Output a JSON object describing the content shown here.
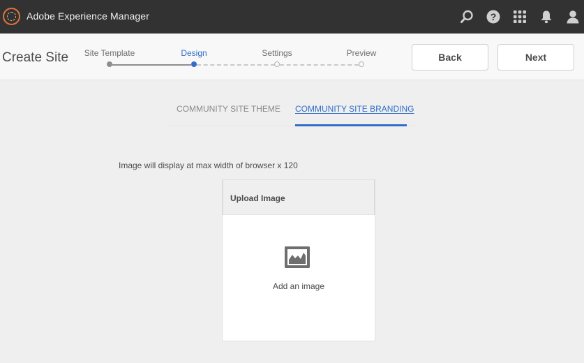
{
  "shell": {
    "app_title": "Adobe Experience Manager",
    "icons": [
      "search-icon",
      "help-icon",
      "solutions-grid-icon",
      "notifications-bell-icon",
      "user-avatar-icon"
    ]
  },
  "wizard": {
    "page_title": "Create Site",
    "steps": [
      {
        "label": "Site Template",
        "state": "done"
      },
      {
        "label": "Design",
        "state": "active"
      },
      {
        "label": "Settings",
        "state": "future"
      },
      {
        "label": "Preview",
        "state": "future"
      }
    ],
    "back_label": "Back",
    "next_label": "Next"
  },
  "tabs": [
    {
      "label": "COMMUNITY SITE THEME",
      "active": false
    },
    {
      "label": "COMMUNITY SITE BRANDING",
      "active": true
    }
  ],
  "branding": {
    "hint": "Image will display at max width of browser x 120",
    "upload_header": "Upload Image",
    "add_image_label": "Add an image",
    "icon": "image-placeholder-icon"
  },
  "colors": {
    "shell_bg": "#323232",
    "accent": "#326ec8",
    "logo": "#e0733a"
  }
}
